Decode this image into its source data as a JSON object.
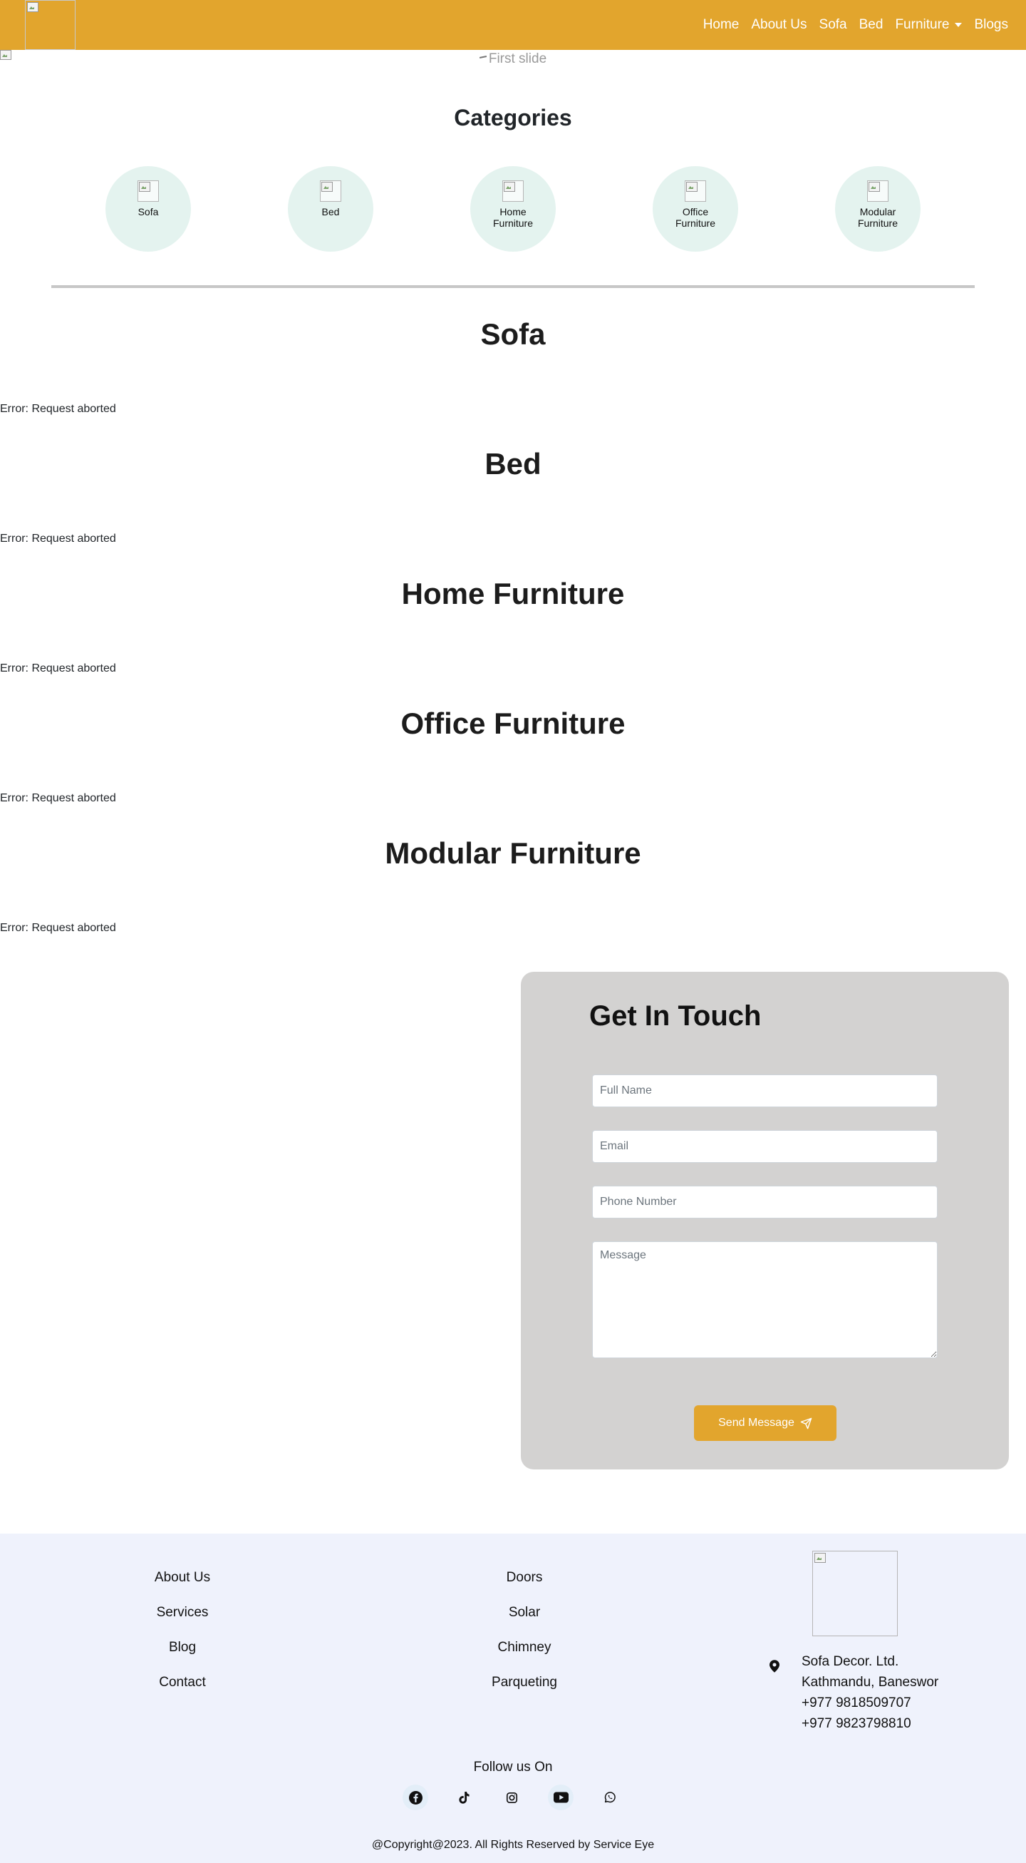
{
  "navbar": {
    "logo_alt": "",
    "links": [
      "Home",
      "About Us",
      "Sofa",
      "Bed",
      "Furniture",
      "Blogs"
    ]
  },
  "hero": {
    "alt": "First slide"
  },
  "categories": {
    "title": "Categories",
    "items": [
      {
        "label": "Sofa"
      },
      {
        "label": "Bed"
      },
      {
        "label": "Home\nFurniture"
      },
      {
        "label": "Office\nFurniture"
      },
      {
        "label": "Modular\nFurniture"
      }
    ]
  },
  "product_sections": [
    {
      "title": "Sofa",
      "error": "Error: Request aborted"
    },
    {
      "title": "Bed",
      "error": "Error: Request aborted"
    },
    {
      "title": "Home Furniture",
      "error": "Error: Request aborted"
    },
    {
      "title": "Office Furniture",
      "error": "Error: Request aborted"
    },
    {
      "title": "Modular Furniture",
      "error": "Error: Request aborted"
    }
  ],
  "contact": {
    "title": "Get In Touch",
    "full_name_placeholder": "Full Name",
    "email_placeholder": "Email",
    "phone_placeholder": "Phone Number",
    "message_placeholder": "Message",
    "send_label": "Send Message"
  },
  "footer": {
    "col1": [
      "About Us",
      "Services",
      "Blog",
      "Contact"
    ],
    "col2": [
      "Doors",
      "Solar",
      "Chimney",
      "Parqueting"
    ],
    "company": "Sofa Decor. Ltd.",
    "address": "Kathmandu, Baneswor",
    "phone1": "+977 9818509707",
    "phone2": "+977 9823798810",
    "follow": "Follow us On",
    "social_icons": [
      "facebook-icon",
      "tiktok-icon",
      "instagram-icon",
      "youtube-icon",
      "whatsapp-icon"
    ],
    "copyright": "@Copyright@2023. All Rights Reserved by Service Eye"
  },
  "colors": {
    "accent": "#e2a52d",
    "category_bg": "#e4f3ef",
    "contact_bg": "#d3d2d1",
    "footer_bg": "#eff2fc"
  }
}
